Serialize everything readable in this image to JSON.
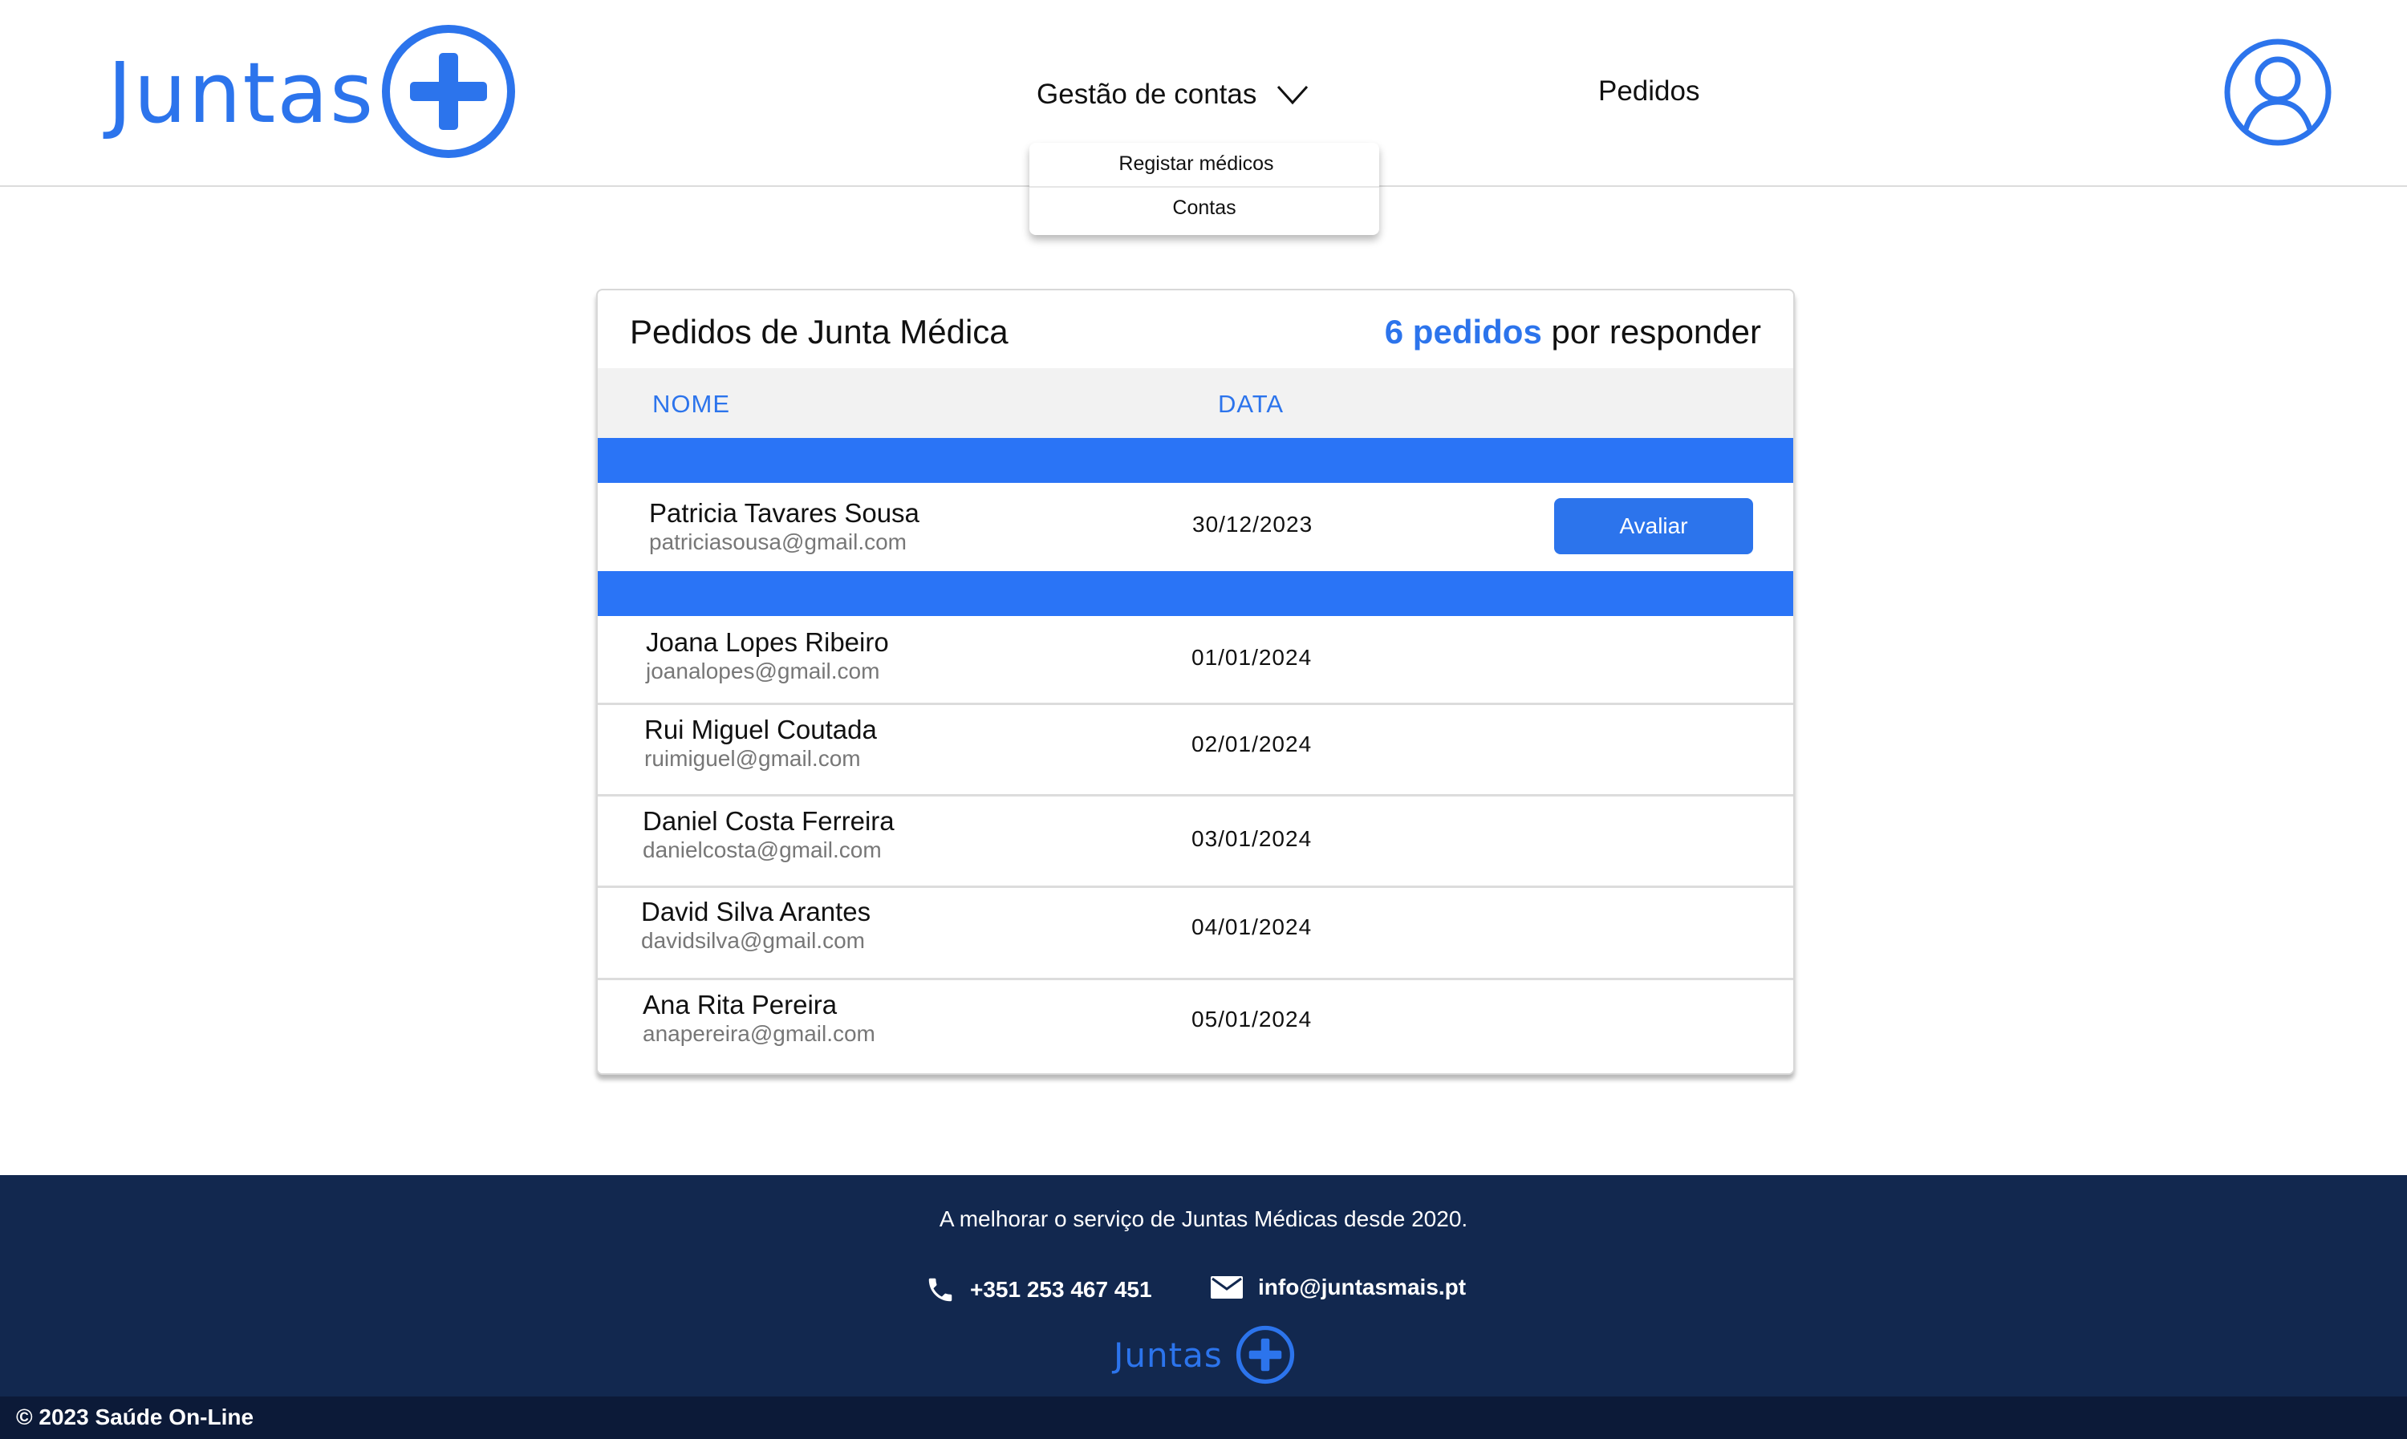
{
  "header": {
    "logo_text": "Juntas",
    "nav": {
      "gestao_label": "Gestão de contas",
      "pedidos_label": "Pedidos"
    },
    "dropdown": {
      "items": [
        {
          "label": "Registar médicos"
        },
        {
          "label": "Contas"
        }
      ]
    }
  },
  "card": {
    "title": "Pedidos de Junta Médica",
    "count_number": "6 pedidos",
    "count_suffix": " por responder",
    "columns": {
      "nome": "NOME",
      "data": "DATA"
    },
    "action_label": "Avaliar",
    "rows": [
      {
        "name": "Patricia Tavares Sousa",
        "email": "patriciasousa@gmail.com",
        "date": "30/12/2023"
      },
      {
        "name": "Joana Lopes Ribeiro",
        "email": "joanalopes@gmail.com",
        "date": "01/01/2024"
      },
      {
        "name": "Rui Miguel Coutada",
        "email": "ruimiguel@gmail.com",
        "date": "02/01/2024"
      },
      {
        "name": "Daniel Costa Ferreira",
        "email": "danielcosta@gmail.com",
        "date": "03/01/2024"
      },
      {
        "name": "David Silva Arantes",
        "email": "davidsilva@gmail.com",
        "date": "04/01/2024"
      },
      {
        "name": "Ana Rita Pereira",
        "email": "anapereira@gmail.com",
        "date": "05/01/2024"
      }
    ]
  },
  "footer": {
    "tagline": "A melhorar o serviço de Juntas Médicas desde 2020.",
    "phone": "+351 253 467 451",
    "email": "info@juntasmais.pt",
    "logo_text": "Juntas",
    "copyright": "© 2023 Saúde On-Line"
  },
  "icons": {
    "logo": "plus-circle-icon",
    "nav_chevron": "chevron-down-icon",
    "avatar": "user-circle-icon",
    "phone": "phone-icon",
    "mail": "envelope-icon"
  },
  "colors": {
    "accent": "#2c74ec",
    "row_highlight": "#2a74f6",
    "footer_bg": "#12284f",
    "bottom_bar_bg": "#0c1a38"
  }
}
